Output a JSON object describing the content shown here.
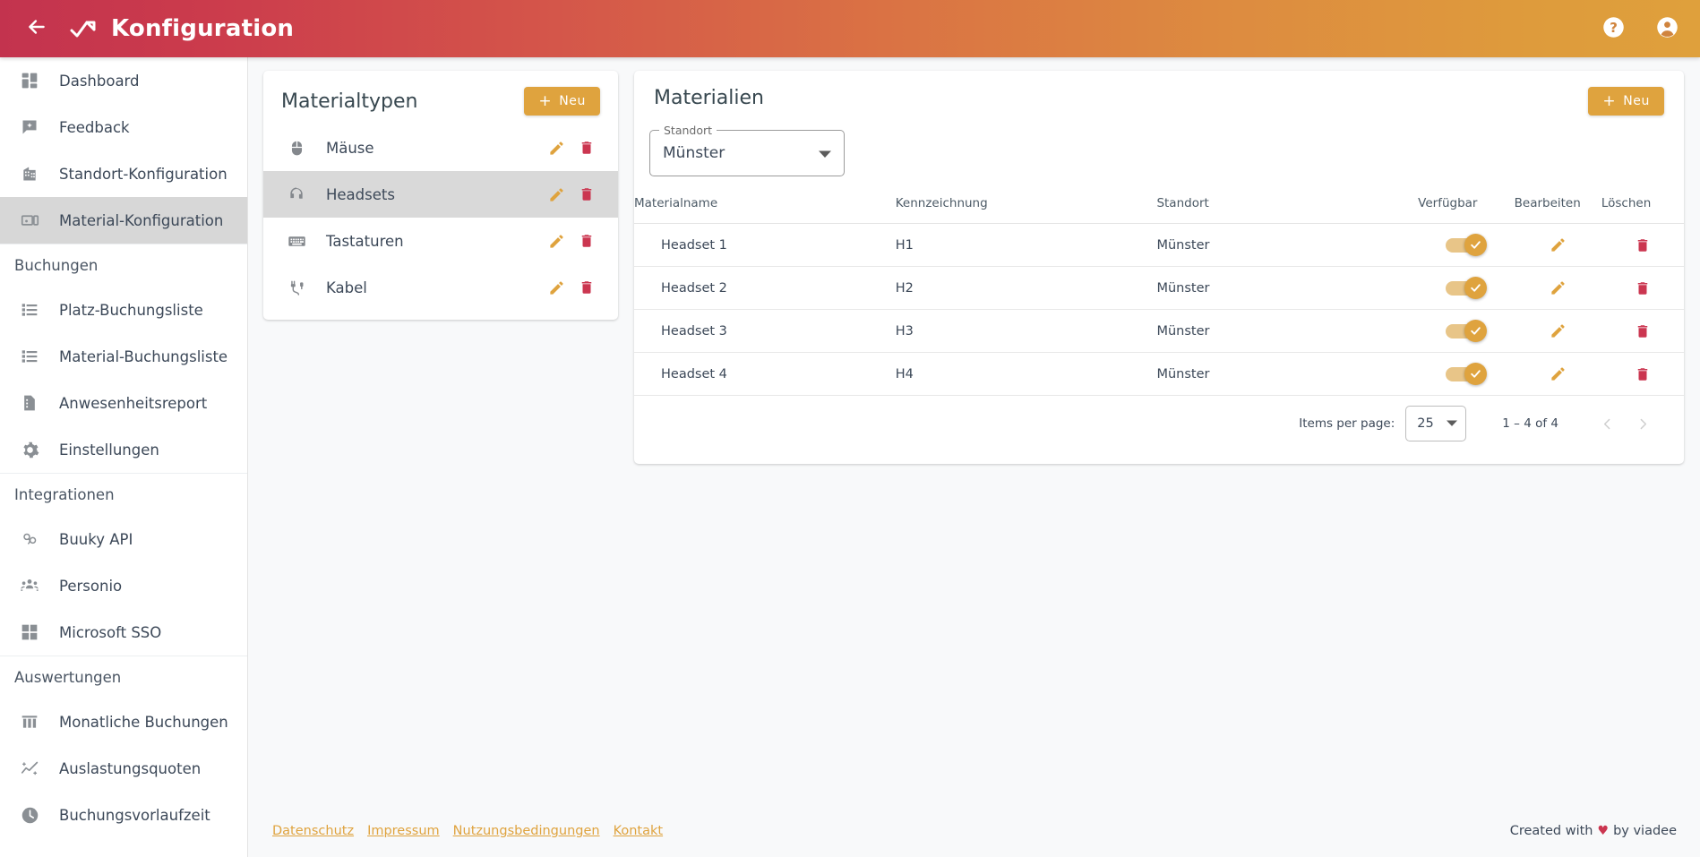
{
  "header": {
    "title": "Konfiguration",
    "back_icon": "arrow-left-icon",
    "logo_icon": "app-logo-icon",
    "help_icon": "help-circle-icon",
    "account_icon": "account-circle-icon"
  },
  "colors": {
    "brand_red": "#c3334e",
    "brand_amber": "#dfa33e",
    "accent_amber": "#dfa33e",
    "danger_red": "#cb3650",
    "page_bg": "#f8f9fa",
    "card_bg": "#ffffff",
    "selected_bg": "#d7d7d7",
    "text": "#3c4858"
  },
  "sidebar": {
    "items": [
      {
        "label": "Dashboard",
        "icon": "dashboard-icon",
        "type": "item",
        "active": false
      },
      {
        "label": "Feedback",
        "icon": "feedback-icon",
        "type": "item",
        "active": false
      },
      {
        "label": "Standort-Konfiguration",
        "icon": "building-icon",
        "type": "item",
        "active": false
      },
      {
        "label": "Material-Konfiguration",
        "icon": "devices-icon",
        "type": "item",
        "active": true
      },
      {
        "label": "Buchungen",
        "type": "section"
      },
      {
        "label": "Platz-Buchungsliste",
        "icon": "list-icon",
        "type": "item",
        "active": false
      },
      {
        "label": "Material-Buchungsliste",
        "icon": "list-icon",
        "type": "item",
        "active": false
      },
      {
        "label": "Anwesenheitsreport",
        "icon": "document-icon",
        "type": "item",
        "active": false
      },
      {
        "label": "Einstellungen",
        "icon": "gear-icon",
        "type": "item",
        "active": false
      },
      {
        "label": "Integrationen",
        "type": "section"
      },
      {
        "label": "Buuky API",
        "icon": "api-icon",
        "type": "item",
        "active": false
      },
      {
        "label": "Personio",
        "icon": "people-icon",
        "type": "item",
        "active": false
      },
      {
        "label": "Microsoft SSO",
        "icon": "microsoft-icon",
        "type": "item",
        "active": false
      },
      {
        "label": "Auswertungen",
        "type": "section"
      },
      {
        "label": "Monatliche Buchungen",
        "icon": "bar-chart-icon",
        "type": "item",
        "active": false
      },
      {
        "label": "Auslastungsquoten",
        "icon": "trend-icon",
        "type": "item",
        "active": false
      },
      {
        "label": "Buchungsvorlaufzeit",
        "icon": "clock-icon",
        "type": "item",
        "active": false
      }
    ]
  },
  "material_types": {
    "title": "Materialtypen",
    "new_button": "Neu",
    "rows": [
      {
        "name": "Mäuse",
        "icon": "mouse-icon",
        "active": false
      },
      {
        "name": "Headsets",
        "icon": "headset-icon",
        "active": true
      },
      {
        "name": "Tastaturen",
        "icon": "keyboard-icon",
        "active": false
      },
      {
        "name": "Kabel",
        "icon": "cable-icon",
        "active": false
      }
    ]
  },
  "materials": {
    "title": "Materialien",
    "new_button": "Neu",
    "location_select": {
      "label": "Standort",
      "value": "Münster"
    },
    "columns": [
      "Materialname",
      "Kennzeichnung",
      "Standort",
      "Verfügbar",
      "Bearbeiten",
      "Löschen"
    ],
    "rows": [
      {
        "name": "Headset 1",
        "kennzeichnung": "H1",
        "standort": "Münster",
        "verfuegbar": true
      },
      {
        "name": "Headset 2",
        "kennzeichnung": "H2",
        "standort": "Münster",
        "verfuegbar": true
      },
      {
        "name": "Headset 3",
        "kennzeichnung": "H3",
        "standort": "Münster",
        "verfuegbar": true
      },
      {
        "name": "Headset 4",
        "kennzeichnung": "H4",
        "standort": "Münster",
        "verfuegbar": true
      }
    ],
    "paginator": {
      "items_per_page_label": "Items per page:",
      "page_size": "25",
      "range_label": "1 – 4 of 4",
      "prev_icon": "chevron-left-icon",
      "next_icon": "chevron-right-icon"
    }
  },
  "footer": {
    "links": [
      "Datenschutz",
      "Impressum",
      "Nutzungsbedingungen",
      "Kontakt"
    ],
    "credit_prefix": "Created with",
    "credit_heart": "♥",
    "credit_suffix": "by viadee"
  }
}
